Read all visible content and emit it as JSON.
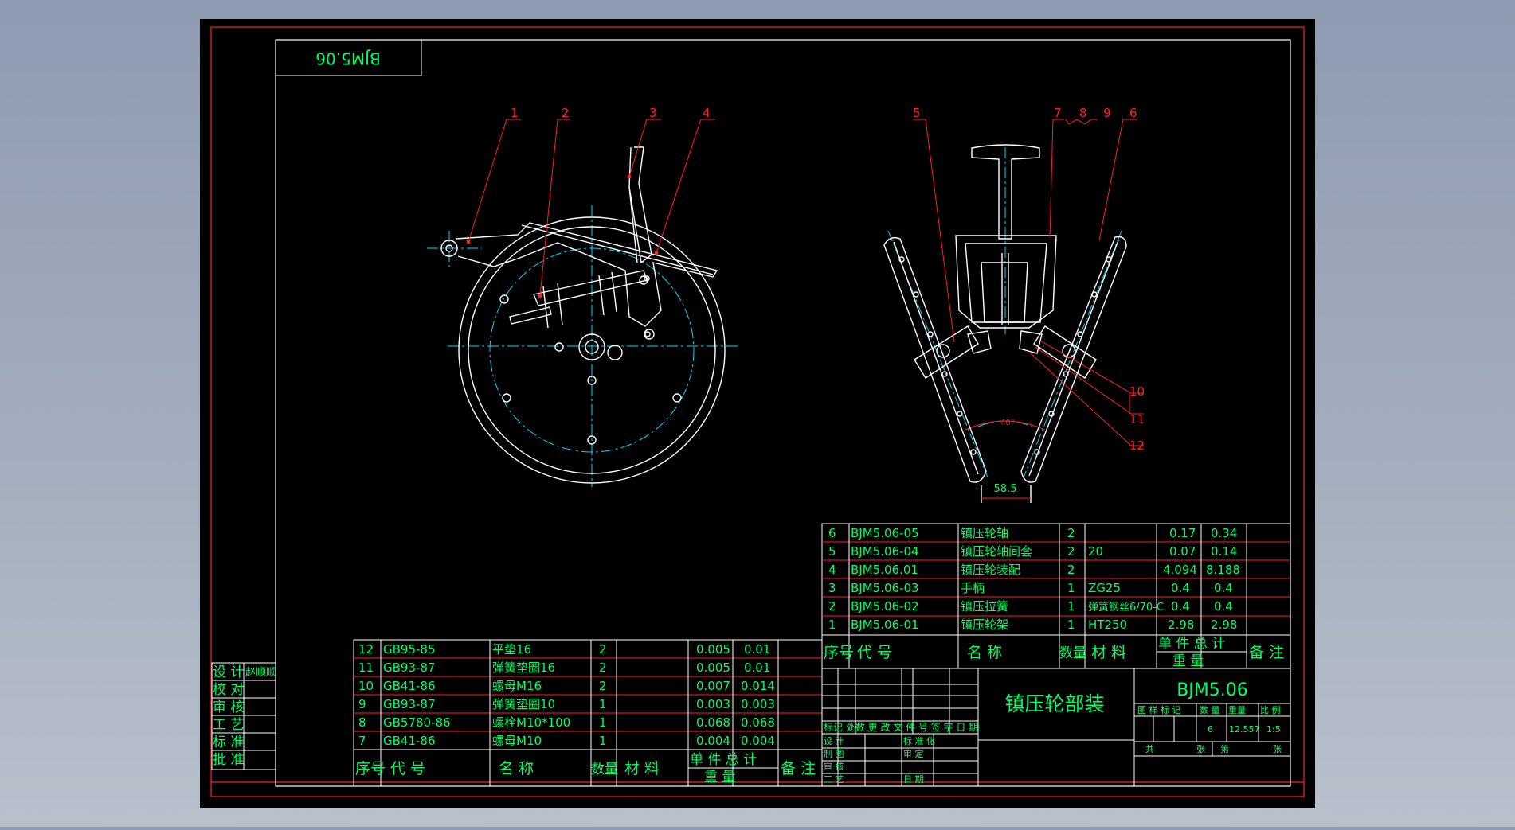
{
  "drawing": {
    "stamp_code": "BJM5.06",
    "title": "镇压轮部装",
    "code": "BJM5.06"
  },
  "balloons": [
    "1",
    "2",
    "3",
    "4",
    "5",
    "7",
    "8",
    "9",
    "6",
    "10",
    "11",
    "12"
  ],
  "dimensions": {
    "angle": "40°",
    "width": "58.5"
  },
  "parts_right": {
    "rows": [
      [
        "6",
        "BJM5.06-05",
        "镇压轮轴",
        "2",
        "",
        "0.17",
        "0.34"
      ],
      [
        "5",
        "BJM5.06-04",
        "镇压轮轴间套",
        "2",
        "20",
        "0.07",
        "0.14"
      ],
      [
        "4",
        "BJM5.06.01",
        "镇压轮装配",
        "2",
        "",
        "4.094",
        "8.188"
      ],
      [
        "3",
        "BJM5.06-03",
        "手柄",
        "1",
        "ZG25",
        "0.4",
        "0.4"
      ],
      [
        "2",
        "BJM5.06-02",
        "镇压拉簧",
        "1",
        "弹簧钢丝6/70-C",
        "0.4",
        "0.4"
      ],
      [
        "1",
        "BJM5.06-01",
        "镇压轮架",
        "1",
        "HT250",
        "2.98",
        "2.98"
      ]
    ]
  },
  "parts_left": {
    "rows": [
      [
        "12",
        "GB95-85",
        "平垫16",
        "2",
        "",
        "0.005",
        "0.01"
      ],
      [
        "11",
        "GB93-87",
        "弹簧垫圈16",
        "2",
        "",
        "0.005",
        "0.01"
      ],
      [
        "10",
        "GB41-86",
        "螺母M16",
        "2",
        "",
        "0.007",
        "0.014"
      ],
      [
        "9",
        "GB93-87",
        "弹簧垫圈10",
        "1",
        "",
        "0.003",
        "0.003"
      ],
      [
        "8",
        "GB5780-86",
        "螺栓M10*100",
        "1",
        "",
        "0.068",
        "0.068"
      ],
      [
        "7",
        "GB41-86",
        "螺母M10",
        "1",
        "",
        "0.004",
        "0.004"
      ]
    ]
  },
  "headers": {
    "seq": "序号",
    "code": "代  号",
    "name": "名  称",
    "qty": "数量",
    "material": "材  料",
    "unit_total": "单 件 总 计",
    "weight": "重  量",
    "remark": "备 注"
  },
  "side_block": [
    "设 计",
    "校 对",
    "审 核",
    "工 艺",
    "标 准",
    "批 准"
  ],
  "side_sign": "赵顺顺",
  "title_block": {
    "rev_header": "标记 处数 更 改 文 件 号 签 字 日 期",
    "roles": [
      "设 计",
      "制 图",
      "审 核",
      "工 艺"
    ],
    "approvals": [
      "标 准 化",
      "审 定",
      "日 期"
    ],
    "stage_header": "图 样 标 记",
    "qty_header": "数 量",
    "weight_header": "重量",
    "scale_header": "比 例",
    "qty": "6",
    "weight": "12.557",
    "scale": "1:5",
    "sheets_total": "共",
    "sheets_label": "张",
    "sheet_no": "第",
    "sheet_label": "张"
  },
  "colors": {
    "background": "#000000",
    "frame_red": "#ff2020",
    "outline_white": "#ffffff",
    "centerline_cyan": "#00d8ff",
    "text_green": "#00ff66",
    "desktop": "#9aa5b6"
  }
}
